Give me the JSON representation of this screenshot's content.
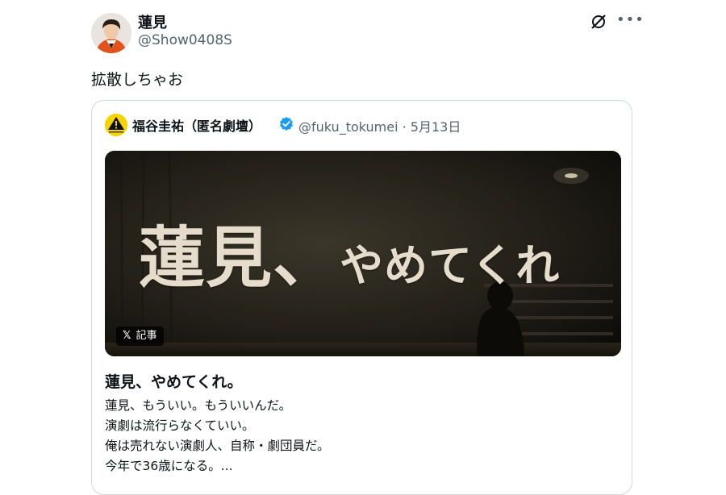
{
  "tweet": {
    "display_name": "蓮見",
    "handle": "@Show0408S",
    "text": "拡散しちゃお",
    "more_icon": "more-horizontal-icon",
    "grok_icon": "grok-icon"
  },
  "quote": {
    "display_name": "福谷圭祐（匿名劇壇）",
    "verified_icon": "verified-badge-icon",
    "meta": "@fuku_tokumei · 5月13日",
    "image": {
      "headline_big": "蓮見、",
      "headline_small": "やめてくれ",
      "badge_label": "記事",
      "badge_icon": "x-logo-icon",
      "badge_icon_glyph": "𝕏"
    },
    "article_title": "蓮見、やめてくれ。",
    "article_lines": [
      "蓮見、もういい。もういいんだ。",
      "演劇は流行らなくていい。",
      "俺は売れない演劇人、自称・劇団員だ。",
      "今年で36歳になる。..."
    ]
  },
  "colors": {
    "text_primary": "#0f1419",
    "text_secondary": "#536471",
    "border": "#cfd9de",
    "verified_blue": "#1d9bf0",
    "headline_cream": "#e6dccb"
  }
}
